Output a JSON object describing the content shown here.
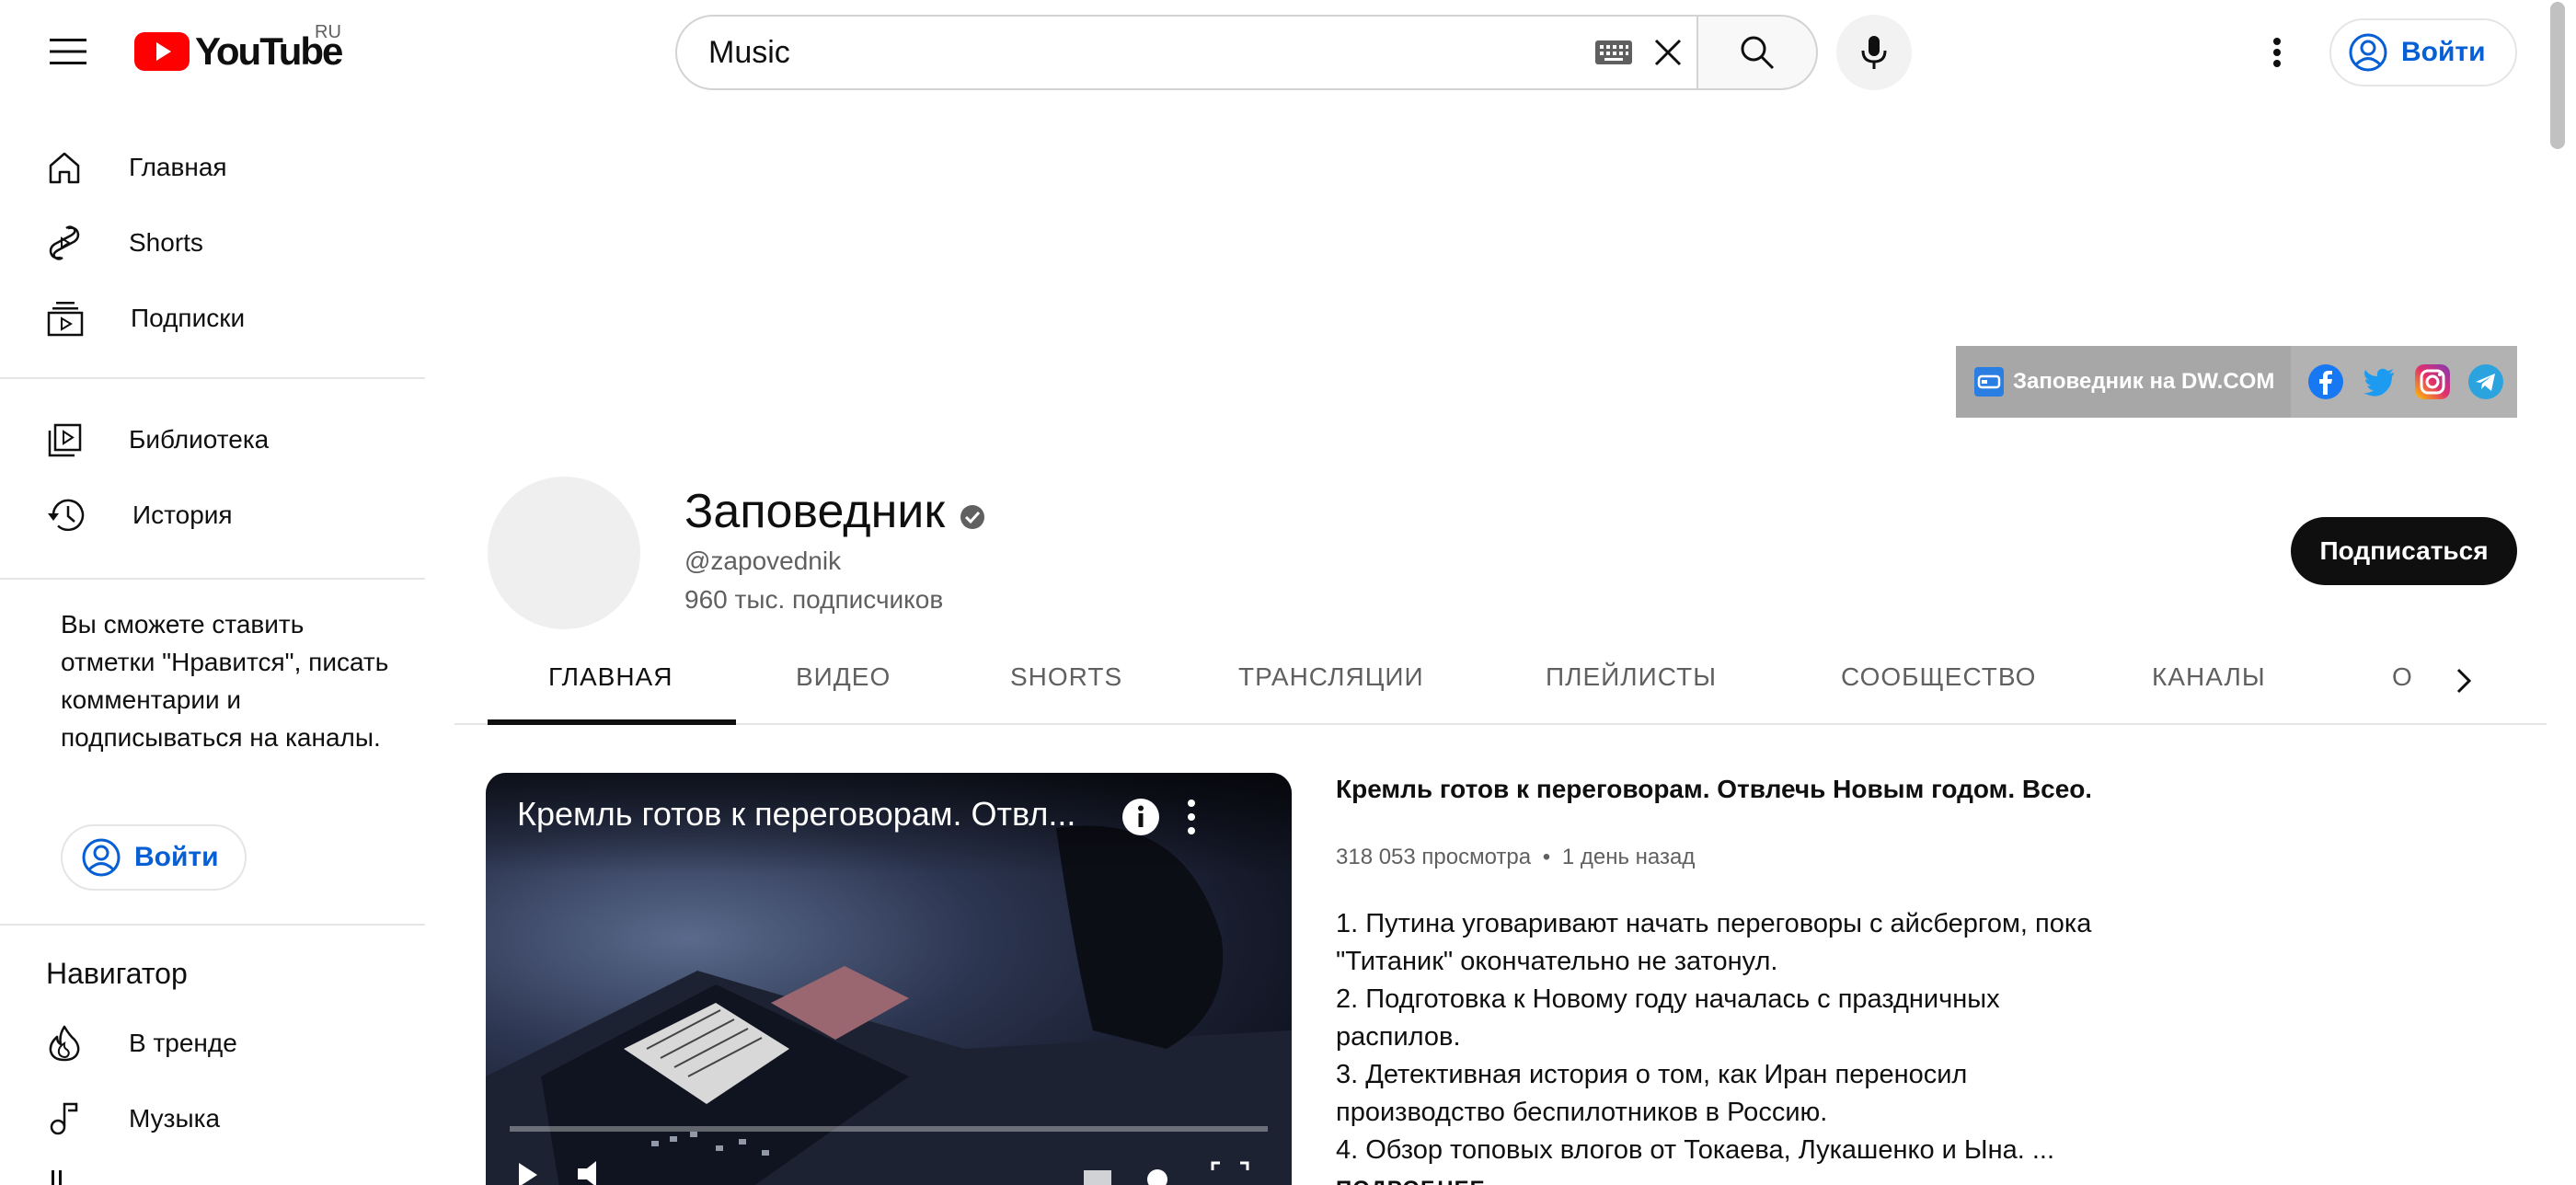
{
  "header": {
    "logo_text": "YouTube",
    "country_code": "RU",
    "search_value": "Music",
    "signin_label": "Войти"
  },
  "sidebar": {
    "items": [
      {
        "label": "Главная",
        "icon": "home-icon"
      },
      {
        "label": "Shorts",
        "icon": "shorts-icon"
      },
      {
        "label": "Подписки",
        "icon": "subscriptions-icon"
      },
      {
        "label": "Библиотека",
        "icon": "library-icon"
      },
      {
        "label": "История",
        "icon": "history-icon"
      }
    ],
    "signin_note": "Вы сможете ставить отметки \"Нравится\", писать комментарии и подписываться на каналы.",
    "signin_label": "Войти",
    "navigator_title": "Навигатор",
    "navigator_items": [
      {
        "label": "В тренде",
        "icon": "trending-icon"
      },
      {
        "label": "Музыка",
        "icon": "music-icon"
      }
    ]
  },
  "banner": {
    "link_label": "Заповедник на DW.COM",
    "social_icons": [
      "facebook-icon",
      "twitter-icon",
      "instagram-icon",
      "telegram-icon"
    ]
  },
  "channel": {
    "name": "Заповедник",
    "handle": "@zapovednik",
    "subscribers": "960 тыс. подписчиков",
    "subscribe_label": "Подписаться"
  },
  "tabs": [
    "ГЛАВНАЯ",
    "ВИДЕО",
    "SHORTS",
    "ТРАНСЛЯЦИИ",
    "ПЛЕЙЛИСТЫ",
    "СООБЩЕСТВО",
    "КАНАЛЫ",
    "О"
  ],
  "active_tab": "ГЛАВНАЯ",
  "featured_video": {
    "player_title": "Кремль готов к переговорам. Отвл...",
    "title": "Кремль готов к переговорам. Отвлечь Новым годом. Всео...",
    "views": "318 053 просмотра",
    "separator": "•",
    "age": "1 день назад",
    "description": [
      "1. Путина уговаривают начать переговоры с айсбергом, пока \"Титаник\" окончательно не затонул.",
      "2. Подготовка к Новому году началась с праздничных распилов.",
      "3. Детективная история о том, как Иран переносил производство беспилотников в Россию.",
      "4. Обзор топовых влогов от Токаева, Лукашенко и Ына. ..."
    ],
    "more_label": "ПОДРОБНЕЕ"
  },
  "colors": {
    "link_blue": "#065fd4",
    "subscribe_bg": "#0f0f0f",
    "youtube_red": "#ff0000"
  }
}
